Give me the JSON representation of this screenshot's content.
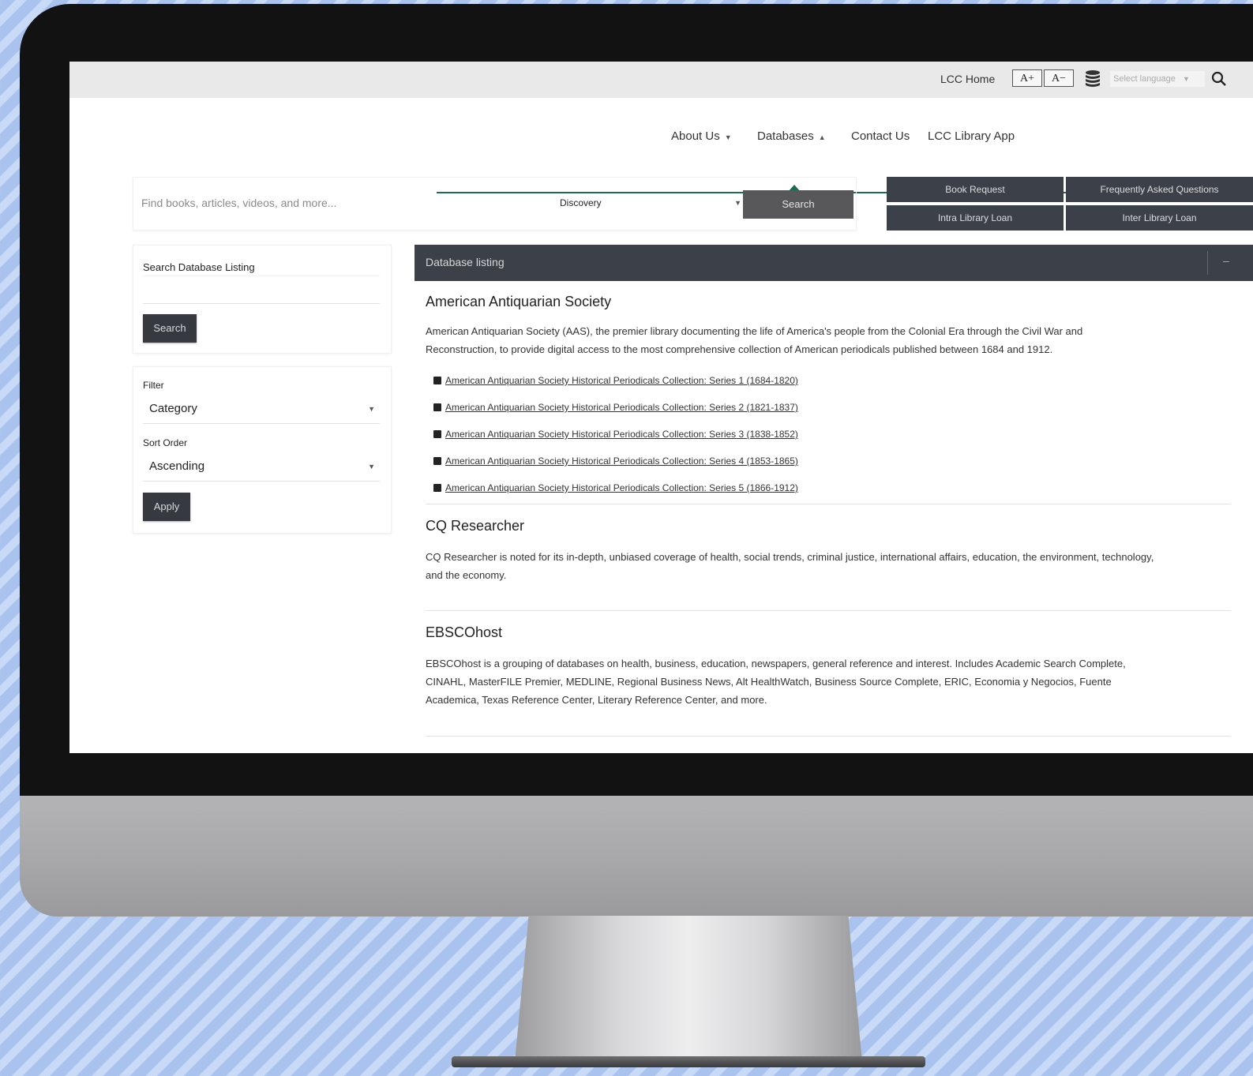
{
  "utility_bar": {
    "home_label": "LCC Home",
    "font_increase": "A+",
    "font_decrease": "A−",
    "language_placeholder": "Select language"
  },
  "main_nav": {
    "items": [
      {
        "label": "About Us",
        "has_dropdown": true
      },
      {
        "label": "Databases",
        "has_dropdown": true
      },
      {
        "label": "Contact Us",
        "has_dropdown": false
      },
      {
        "label": "LCC Library App",
        "has_dropdown": false
      }
    ]
  },
  "search": {
    "placeholder": "Find books, articles, videos, and more...",
    "scope_value": "Discovery",
    "button_label": "Search"
  },
  "quick_links": [
    "Book Request",
    "Frequently Asked Questions",
    "Intra Library Loan",
    "Inter Library Loan"
  ],
  "sidebar": {
    "search_label": "Search Database Listing",
    "search_button": "Search",
    "filter_label": "Filter",
    "filter_value": "Category",
    "sort_label": "Sort Order",
    "sort_value": "Ascending",
    "apply_button": "Apply"
  },
  "listing": {
    "header": "Database listing",
    "databases": [
      {
        "title": "American Antiquarian Society",
        "description_lines": [
          "American Antiquarian Society (AAS), the premier library documenting the life of America's people from the Colonial Era through the Civil War and",
          "Reconstruction, to provide digital access to the most comprehensive collection of American periodicals published between 1684 and 1912."
        ],
        "links": [
          "American Antiquarian Society Historical Periodicals Collection: Series 1 (1684-1820)",
          "American Antiquarian Society Historical Periodicals Collection: Series 2 (1821-1837)",
          "American Antiquarian Society Historical Periodicals Collection: Series 3 (1838-1852)",
          "American Antiquarian Society Historical Periodicals Collection: Series 4 (1853-1865)",
          "American Antiquarian Society Historical Periodicals Collection: Series 5 (1866-1912)"
        ]
      },
      {
        "title": "CQ Researcher",
        "description_lines": [
          "CQ Researcher is noted for its in-depth, unbiased coverage of health, social trends, criminal justice, international affairs, education, the environment, technology,",
          "and the economy."
        ]
      },
      {
        "title": "EBSCOhost",
        "description_lines": [
          "EBSCOhost is a grouping of databases on health, business, education, newspapers, general reference and interest. Includes Academic Search Complete,",
          "CINAHL, MasterFILE Premier, MEDLINE, Regional Business News, Alt HealthWatch, Business Source Complete, ERIC, Economia y Negocios, Fuente",
          "Academica, Texas Reference Center, Literary Reference Center, and more."
        ]
      }
    ]
  }
}
